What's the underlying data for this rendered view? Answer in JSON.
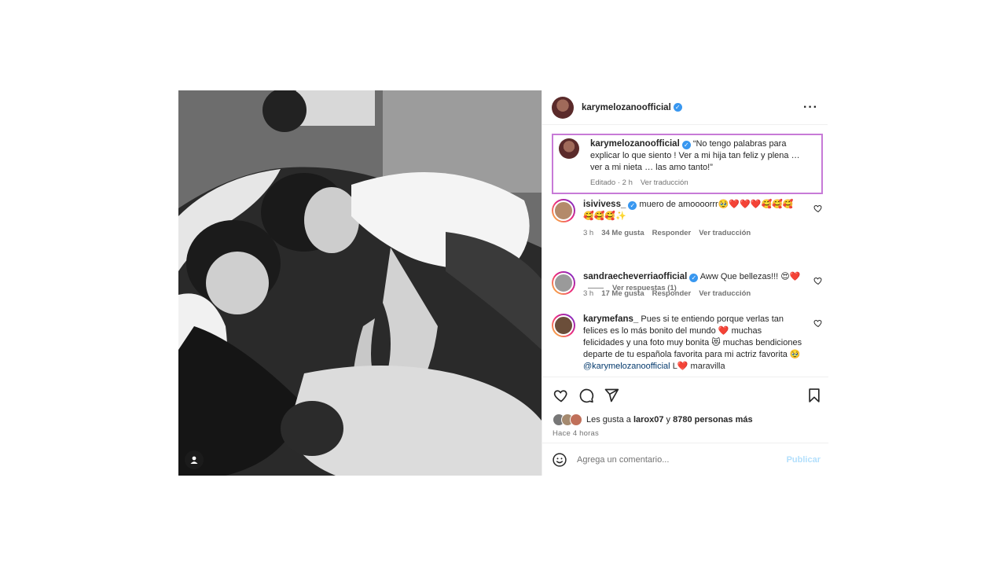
{
  "post": {
    "author": "karymelozanoofficial",
    "caption": {
      "text": "“No tengo palabras para explicar lo que siento ! Ver a mi hija tan feliz y plena … ver a mi nieta … las amo tanto!”",
      "edited": "Editado · 2 h",
      "translate": "Ver traducción"
    },
    "comments": [
      {
        "username": "isivivess_",
        "text": "muero de amoooorrr🥹❤️❤️❤️🥰🥰🥰🥰🥰🥰✨",
        "time": "3 h",
        "likes": "34 Me gusta",
        "reply": "Responder",
        "translate": "Ver traducción",
        "replies": "Ver respuestas (1)"
      },
      {
        "username": "sandraecheverriaofficial",
        "text": "Aww Que bellezas!!! 😍❤️",
        "time": "3 h",
        "likes": "17 Me gusta",
        "reply": "Responder",
        "translate": "Ver traducción"
      },
      {
        "username": "karymefans_",
        "text": "Pues si te entiendo porque verlas tan felices es lo más bonito del mundo ❤️ muchas felicidades y una foto muy bonita 😻 muchas bendiciones departe de tu española favorita para mi actriz favorita 🥹",
        "mention": "@karymelozanoofficial",
        "tail": "L❤️ maravilla"
      }
    ],
    "likes": {
      "prefix": "Les gusta a",
      "user": "larox07",
      "conj": "y",
      "others": "8780 personas más"
    },
    "time_ago": "Hace 4 horas",
    "add_comment": {
      "placeholder": "Agrega un comentario...",
      "publish": "Publicar"
    }
  },
  "icons": {
    "more": "more-options-icon",
    "like": "heart-icon",
    "comment": "comment-icon",
    "share": "share-icon",
    "save": "bookmark-icon",
    "emoji": "emoji-icon",
    "tag": "user-tag-icon",
    "verified": "verified-badge-icon"
  },
  "colors": {
    "verified": "#3897f0",
    "highlight_border": "#c77ad7",
    "heart_red": "#ed4956",
    "publish_disabled": "#b2dffc"
  }
}
